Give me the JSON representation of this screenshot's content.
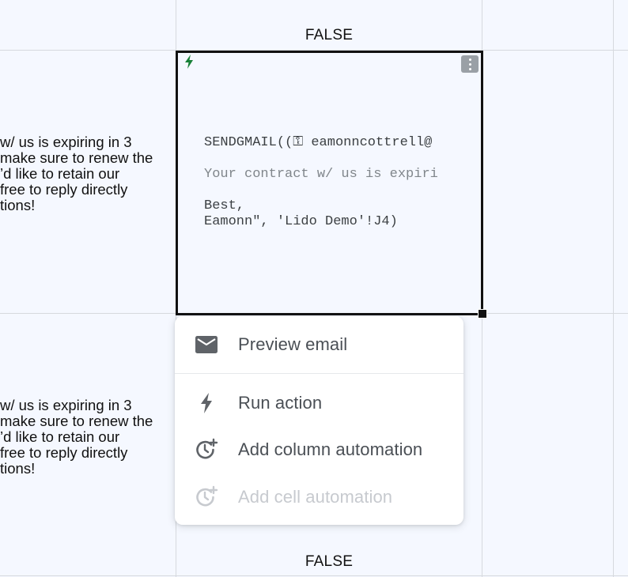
{
  "cells": {
    "top_bool": "FALSE",
    "bottom_bool": "FALSE",
    "left_text_row1": [
      "w/ us is expiring in 3",
      "make sure to renew the",
      "’d like to retain our",
      " free to reply directly",
      "tions!"
    ],
    "left_text_row2": [
      "w/ us is expiring in 3",
      "make sure to renew the",
      "’d like to retain our",
      " free to reply directly",
      "tions!"
    ]
  },
  "active_cell": {
    "formula_line1": "SENDGMAIL((⚿ eamonncottrell@",
    "formula_line2": "Your contract w/ us is expiri",
    "formula_line3": "Best,",
    "formula_line4": "Eamonn\", 'Lido Demo'!J4)"
  },
  "menu": {
    "items": [
      {
        "label": "Preview email",
        "icon": "mail-icon",
        "enabled": true
      },
      {
        "label": "Run action",
        "icon": "bolt-icon",
        "enabled": true
      },
      {
        "label": "Add column automation",
        "icon": "clock-plus-icon",
        "enabled": true
      },
      {
        "label": "Add cell automation",
        "icon": "clock-plus-icon",
        "enabled": false
      }
    ]
  },
  "colors": {
    "background": "#f5f8ff",
    "bolt_green": "#188038",
    "menu_text": "#4a4f55",
    "disabled_text": "#c7cacf"
  }
}
